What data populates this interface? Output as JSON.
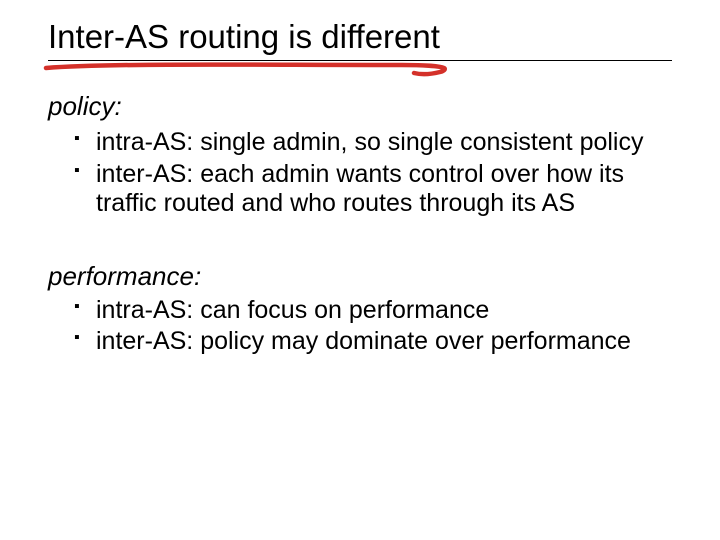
{
  "title": "Inter-AS routing is different",
  "sections": {
    "policy": {
      "heading": "policy:",
      "items": [
        "intra-AS: single admin, so single consistent policy",
        "inter-AS: each admin wants control over how its traffic routed and who routes through its AS"
      ]
    },
    "performance": {
      "heading": "performance:",
      "items": [
        "intra-AS: can focus on performance",
        "inter-AS: policy may dominate over performance"
      ]
    }
  },
  "colors": {
    "underline": "#d4312a"
  }
}
